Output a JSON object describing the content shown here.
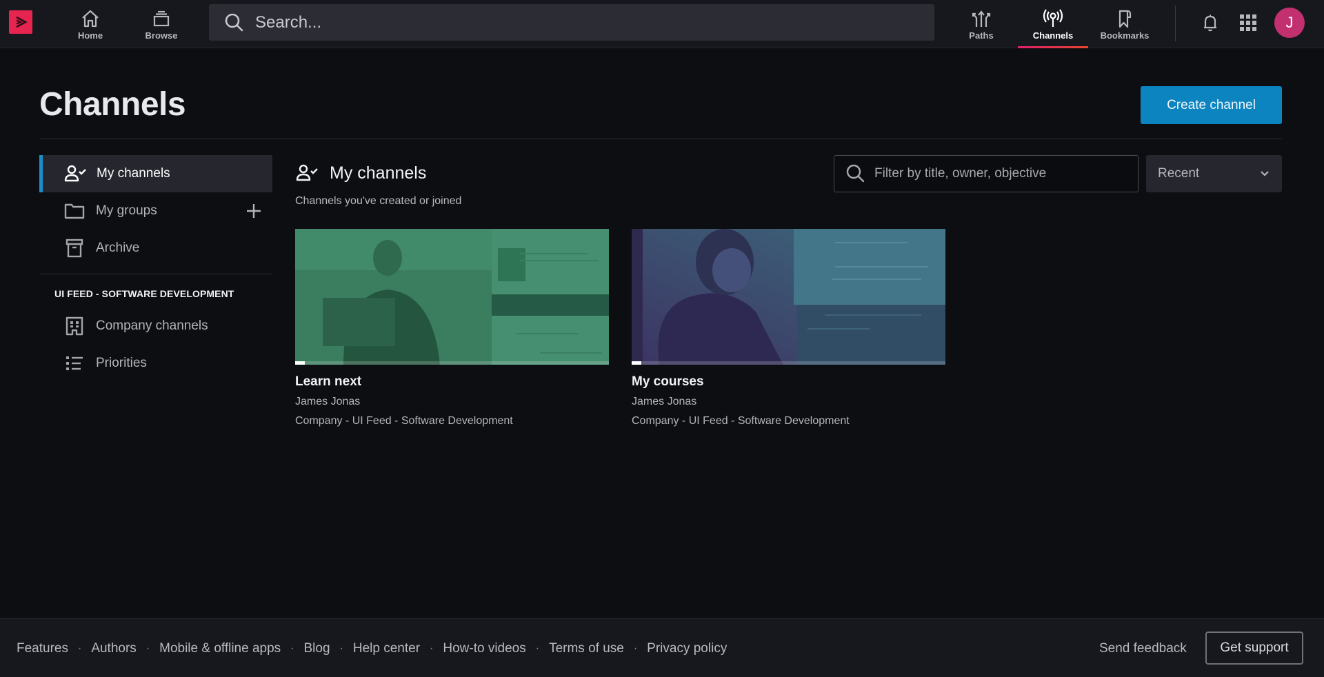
{
  "topnav": {
    "logo_icon": "play-logo-icon",
    "items": [
      {
        "label": "Home",
        "icon": "home-icon",
        "active": false
      },
      {
        "label": "Browse",
        "icon": "browse-stack-icon",
        "active": false
      },
      {
        "label": "Paths",
        "icon": "paths-arrows-icon",
        "active": false
      },
      {
        "label": "Channels",
        "icon": "broadcast-antenna-icon",
        "active": true
      },
      {
        "label": "Bookmarks",
        "icon": "bookmark-icon",
        "active": false
      }
    ],
    "search_placeholder": "Search...",
    "notifications_icon": "bell-icon",
    "apps_icon": "grid-icon",
    "avatar_initial": "J",
    "active_indicator_colors": [
      "#e3206b",
      "#e9452f"
    ]
  },
  "page": {
    "title": "Channels",
    "create_button": "Create channel",
    "accent_color": "#0c84c0"
  },
  "sidebar": {
    "items": [
      {
        "label": "My channels",
        "icon": "person-check-icon",
        "active": true
      },
      {
        "label": "My groups",
        "icon": "folder-icon",
        "active": false,
        "action_icon": "plus-icon"
      },
      {
        "label": "Archive",
        "icon": "archive-box-icon",
        "active": false
      }
    ],
    "section_title": "UI FEED - SOFTWARE DEVELOPMENT",
    "section_items": [
      {
        "label": "Company channels",
        "icon": "building-icon"
      },
      {
        "label": "Priorities",
        "icon": "list-icon"
      }
    ]
  },
  "main": {
    "heading": "My channels",
    "subheading": "Channels you've created or joined",
    "filter_placeholder": "Filter by title, owner, objective",
    "sort": {
      "selected": "Recent"
    },
    "cards": [
      {
        "title": "Learn next",
        "owner": "James Jonas",
        "org": "Company - UI Feed - Software Development",
        "progress_percent": 3,
        "tint": "green"
      },
      {
        "title": "My courses",
        "owner": "James Jonas",
        "org": "Company - UI Feed - Software Development",
        "progress_percent": 3,
        "tint": "purple"
      }
    ]
  },
  "footer": {
    "links": [
      "Features",
      "Authors",
      "Mobile & offline apps",
      "Blog",
      "Help center",
      "How-to videos",
      "Terms of use",
      "Privacy policy"
    ],
    "separator": "·",
    "feedback": "Send feedback",
    "support": "Get support"
  }
}
